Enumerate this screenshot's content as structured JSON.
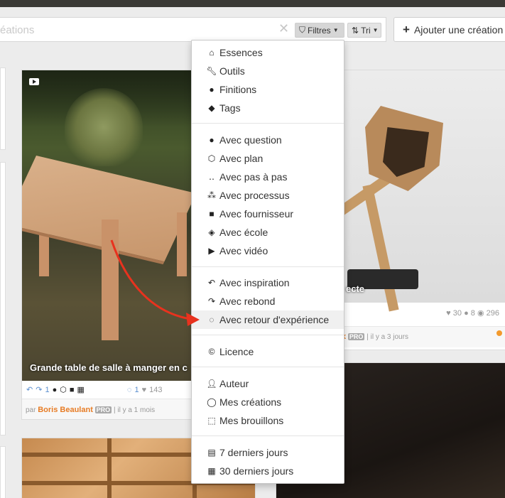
{
  "search": {
    "placeholder_visible": "éations",
    "filter_label": "Filtres",
    "sort_label": "Tri"
  },
  "add_button": {
    "label": "Ajouter une création"
  },
  "card1": {
    "title": "Grande table de salle à manger en c",
    "stat_inspiration": "1",
    "stat_feedback": "1",
    "stat_likes": "143",
    "author_prefix": "par",
    "author": "Boris Beaulant",
    "badge": "PRO",
    "date": "il y a 1 mois"
  },
  "card2": {
    "title": "ecte",
    "likes": "30",
    "comments": "8",
    "views": "296",
    "author_tail": "x",
    "badge": "PRO",
    "date": "il y a 3 jours"
  },
  "menu": {
    "items": [
      {
        "label": "Essences",
        "icon": "tree-icon"
      },
      {
        "label": "Outils",
        "icon": "wrench-icon"
      },
      {
        "label": "Finitions",
        "icon": "drop-icon"
      },
      {
        "label": "Tags",
        "icon": "tag-icon"
      },
      {
        "label": "Avec question",
        "icon": "question-bubble-icon"
      },
      {
        "label": "Avec plan",
        "icon": "cube-icon"
      },
      {
        "label": "Avec pas à pas",
        "icon": "footsteps-icon"
      },
      {
        "label": "Avec processus",
        "icon": "sitemap-icon"
      },
      {
        "label": "Avec fournisseur",
        "icon": "truck-icon"
      },
      {
        "label": "Avec école",
        "icon": "graduation-cap-icon"
      },
      {
        "label": "Avec vidéo",
        "icon": "play-icon"
      },
      {
        "label": "Avec inspiration",
        "icon": "undo-arrow-icon"
      },
      {
        "label": "Avec rebond",
        "icon": "redo-arrow-icon"
      },
      {
        "label": "Avec retour d'expérience",
        "icon": "feedback-bubble-icon"
      },
      {
        "label": "Licence",
        "icon": "cc-icon"
      },
      {
        "label": "Auteur",
        "icon": "user-icon"
      },
      {
        "label": "Mes créations",
        "icon": "egg-icon"
      },
      {
        "label": "Mes brouillons",
        "icon": "dashed-square-icon"
      },
      {
        "label": "7 derniers jours",
        "icon": "calendar-icon"
      },
      {
        "label": "30 derniers jours",
        "icon": "calendar-grid-icon"
      }
    ]
  },
  "colors": {
    "accent_orange": "#e77c25",
    "arrow_red": "#e8321e",
    "link_blue": "#5b8fcf"
  }
}
